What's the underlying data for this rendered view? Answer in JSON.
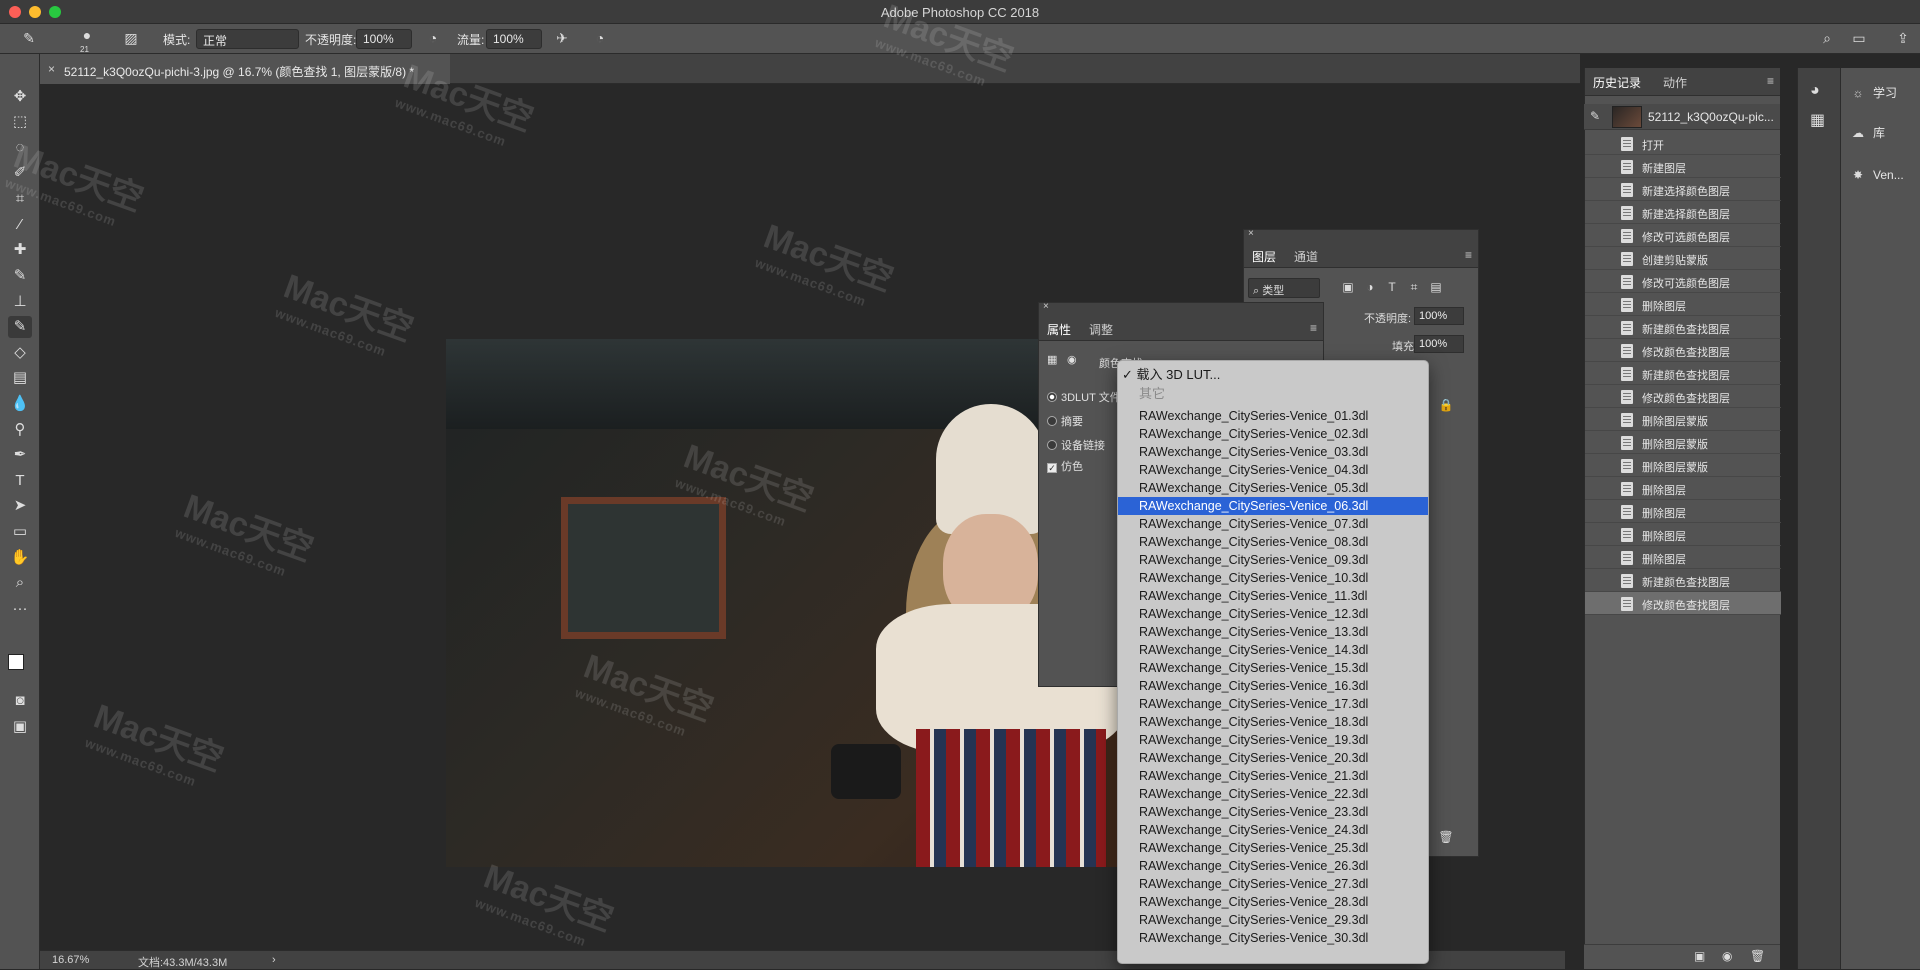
{
  "app_title": "Adobe Photoshop CC 2018",
  "options_bar": {
    "brush_size": "21",
    "mode_label": "模式:",
    "mode_value": "正常",
    "opacity_label": "不透明度:",
    "opacity_value": "100%",
    "flow_label": "流量:",
    "flow_value": "100%"
  },
  "document_tab": "52112_k3Q0ozQu-pichi-3.jpg @ 16.7% (颜色查找 1, 图层蒙版/8) *",
  "status": {
    "zoom": "16.67%",
    "doc_size": "文档:43.3M/43.3M"
  },
  "watermark": {
    "brand": "Mac天空",
    "url": "www.mac69.com"
  },
  "layers_panel": {
    "tabs": [
      "图层",
      "通道"
    ],
    "filter": "类型",
    "opacity_label": "不透明度:",
    "opacity_value": "100%",
    "fill_label": "填充:",
    "fill_value": "100%"
  },
  "properties_panel": {
    "tabs": [
      "属性",
      "调整"
    ],
    "title": "颜色查找",
    "options": [
      "3DLUT 文件",
      "摘要",
      "设备链接"
    ],
    "dither_label": "仿色"
  },
  "lut_dropdown": {
    "load_label": "载入 3D LUT...",
    "other_label": "其它",
    "selected_index": 5,
    "items": [
      "RAWexchange_CitySeries-Venice_01.3dl",
      "RAWexchange_CitySeries-Venice_02.3dl",
      "RAWexchange_CitySeries-Venice_03.3dl",
      "RAWexchange_CitySeries-Venice_04.3dl",
      "RAWexchange_CitySeries-Venice_05.3dl",
      "RAWexchange_CitySeries-Venice_06.3dl",
      "RAWexchange_CitySeries-Venice_07.3dl",
      "RAWexchange_CitySeries-Venice_08.3dl",
      "RAWexchange_CitySeries-Venice_09.3dl",
      "RAWexchange_CitySeries-Venice_10.3dl",
      "RAWexchange_CitySeries-Venice_11.3dl",
      "RAWexchange_CitySeries-Venice_12.3dl",
      "RAWexchange_CitySeries-Venice_13.3dl",
      "RAWexchange_CitySeries-Venice_14.3dl",
      "RAWexchange_CitySeries-Venice_15.3dl",
      "RAWexchange_CitySeries-Venice_16.3dl",
      "RAWexchange_CitySeries-Venice_17.3dl",
      "RAWexchange_CitySeries-Venice_18.3dl",
      "RAWexchange_CitySeries-Venice_19.3dl",
      "RAWexchange_CitySeries-Venice_20.3dl",
      "RAWexchange_CitySeries-Venice_21.3dl",
      "RAWexchange_CitySeries-Venice_22.3dl",
      "RAWexchange_CitySeries-Venice_23.3dl",
      "RAWexchange_CitySeries-Venice_24.3dl",
      "RAWexchange_CitySeries-Venice_25.3dl",
      "RAWexchange_CitySeries-Venice_26.3dl",
      "RAWexchange_CitySeries-Venice_27.3dl",
      "RAWexchange_CitySeries-Venice_28.3dl",
      "RAWexchange_CitySeries-Venice_29.3dl",
      "RAWexchange_CitySeries-Venice_30.3dl"
    ]
  },
  "history_panel": {
    "tabs": [
      "历史记录",
      "动作"
    ],
    "snapshot": "52112_k3Q0ozQu-pic...",
    "items": [
      "打开",
      "新建图层",
      "新建选择颜色图层",
      "新建选择颜色图层",
      "修改可选颜色图层",
      "创建剪贴蒙版",
      "修改可选颜色图层",
      "删除图层",
      "新建颜色查找图层",
      "修改颜色查找图层",
      "新建颜色查找图层",
      "修改颜色查找图层",
      "删除图层蒙版",
      "删除图层蒙版",
      "删除图层蒙版",
      "删除图层",
      "删除图层",
      "删除图层",
      "删除图层",
      "新建颜色查找图层",
      "修改颜色查找图层"
    ]
  },
  "right_rail": {
    "learn": "学习",
    "library": "库",
    "ven": "Ven..."
  },
  "colors": {
    "selection": "#2b63d6",
    "panel": "#535353",
    "canvas": "#282828"
  }
}
